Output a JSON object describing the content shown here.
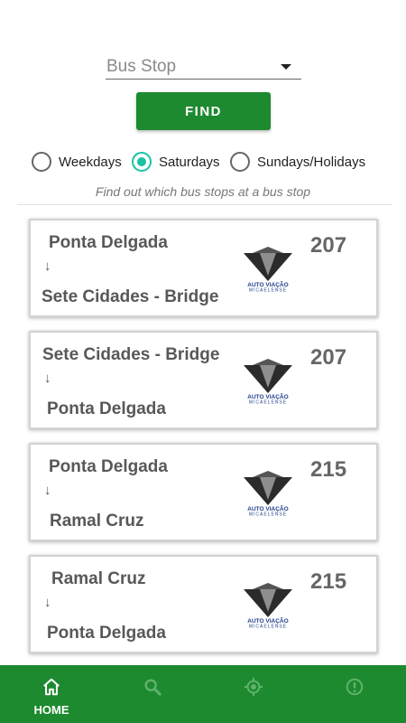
{
  "search": {
    "placeholder": "Bus Stop",
    "find_label": "FIND"
  },
  "day_filter": {
    "options": [
      "Weekdays",
      "Saturdays",
      "Sundays/Holidays"
    ],
    "selected": "Saturdays"
  },
  "hint": "Find out which bus stops at a bus stop",
  "routes": [
    {
      "from": "Ponta Delgada",
      "arrow": "↓",
      "to": "Sete Cidades - Bridge",
      "number": "207",
      "operator_logo_text": [
        "AUTO VIAÇÃO",
        "MICAELENSE"
      ]
    },
    {
      "from": "Sete Cidades - Bridge",
      "arrow": "↓",
      "to": "Ponta Delgada",
      "number": "207",
      "operator_logo_text": [
        "AUTO VIAÇÃO",
        "MICAELENSE"
      ]
    },
    {
      "from": "Ponta Delgada",
      "arrow": "↓",
      "to": "Ramal Cruz",
      "number": "215",
      "operator_logo_text": [
        "AUTO VIAÇÃO",
        "MICAELENSE"
      ]
    },
    {
      "from": "Ramal Cruz",
      "arrow": "↓",
      "to": "Ponta Delgada",
      "number": "215",
      "operator_logo_text": [
        "AUTO VIAÇÃO",
        "MICAELENSE"
      ]
    }
  ],
  "bottom_nav": {
    "items": [
      {
        "label": "HOME",
        "icon": "home-icon",
        "active": true
      },
      {
        "label": "",
        "icon": "search-icon",
        "active": false
      },
      {
        "label": "",
        "icon": "location-icon",
        "active": false
      },
      {
        "label": "",
        "icon": "info-icon",
        "active": false
      }
    ]
  },
  "colors": {
    "primary": "#1e8a30",
    "radio_accent": "#19c2a6",
    "nav_icon_inactive": "#5fb36c"
  }
}
